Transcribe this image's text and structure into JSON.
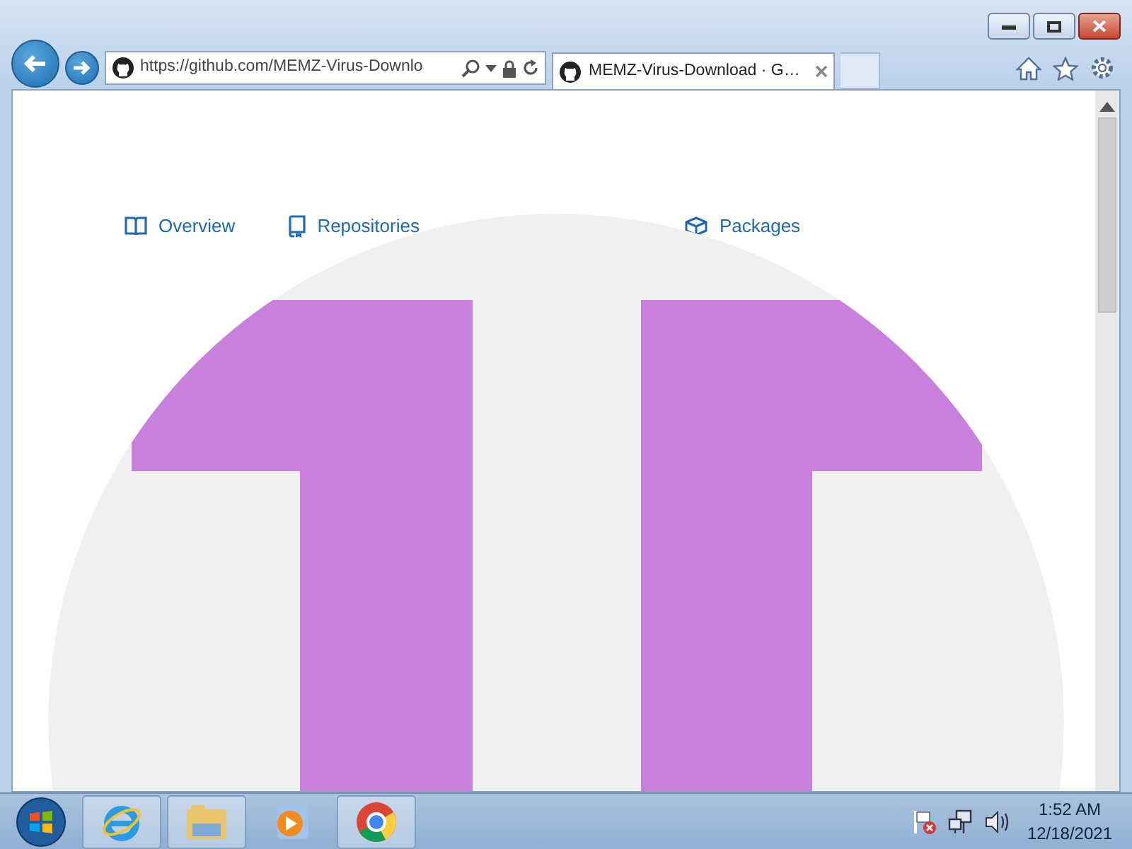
{
  "browser": {
    "address": "https://github.com/MEMZ-Virus-Downlo",
    "tabs": [
      {
        "title": "MEMZ-Virus-Download · G…",
        "selected": true
      }
    ]
  },
  "profile_nav": [
    {
      "label": "Overview"
    },
    {
      "label": "Repositories"
    },
    {
      "label": "Packages"
    }
  ],
  "taskbar": {
    "time": "1:52 AM",
    "date": "12/18/2021"
  }
}
